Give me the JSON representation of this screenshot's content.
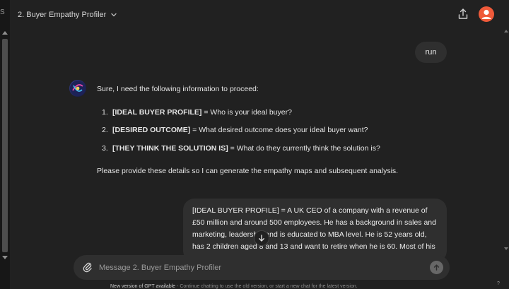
{
  "header": {
    "title": "2. Buyer Empathy Profiler",
    "share_icon": "share-icon",
    "avatar_color": "#ef5a3a"
  },
  "left_strip": {
    "glyph": "S"
  },
  "messages": {
    "user_short": "run",
    "assistant": {
      "intro": "Sure, I need the following information to proceed:",
      "items": [
        {
          "num": "1.",
          "label": "[IDEAL BUYER PROFILE]",
          "text": " = Who is your ideal buyer?"
        },
        {
          "num": "2.",
          "label": "[DESIRED OUTCOME]",
          "text": " = What desired outcome does your ideal buyer want?"
        },
        {
          "num": "3.",
          "label": "[THEY THINK THE SOLUTION IS]",
          "text": " = What do they currently think the solution is?"
        }
      ],
      "outro": "Please provide these details so I can generate the empathy maps and subsequent analysis."
    },
    "user_long": "[IDEAL BUYER PROFILE] = A UK CEO of a company with a revenue of £50 million and around 500 employees. He has a background in sales and marketing, leadership and is educated to MBA level. He is 52 years old, has 2 children aged 8 and 13 and want to retire when he is 60. Most of his free time is spent for sports, family and travel."
  },
  "composer": {
    "placeholder": "Message 2. Buyer Empathy Profiler"
  },
  "footer": {
    "strong": "New version of GPT available",
    "rest": " - Continue chatting to use the old version, or start a new chat for the latest version."
  },
  "help": "?",
  "colors": {
    "background": "#212121",
    "bubble": "#2f2f2f",
    "sidebar": "#171717"
  }
}
